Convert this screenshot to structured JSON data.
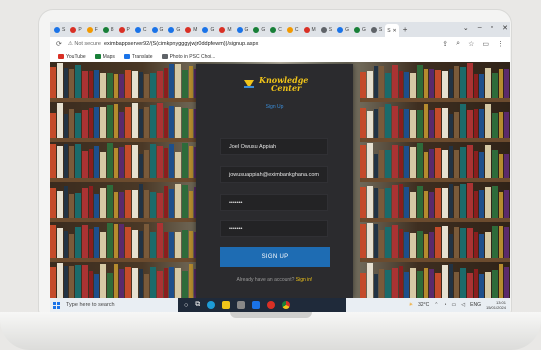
{
  "browser": {
    "tabs": [
      {
        "label": "S",
        "color": "#1a73e8"
      },
      {
        "label": "P",
        "color": "#d93025"
      },
      {
        "label": "F",
        "color": "#f29900"
      },
      {
        "label": "8",
        "color": "#188038"
      },
      {
        "label": "P",
        "color": "#d93025"
      },
      {
        "label": "C",
        "color": "#1a73e8"
      },
      {
        "label": "G",
        "color": "#1a73e8"
      },
      {
        "label": "G",
        "color": "#1a73e8"
      },
      {
        "label": "M",
        "color": "#d93025"
      },
      {
        "label": "G",
        "color": "#1a73e8"
      },
      {
        "label": "M",
        "color": "#d93025"
      },
      {
        "label": "G",
        "color": "#1a73e8"
      },
      {
        "label": "G",
        "color": "#188038"
      },
      {
        "label": "C",
        "color": "#188038"
      },
      {
        "label": "C",
        "color": "#f29900"
      },
      {
        "label": "M",
        "color": "#d93025"
      },
      {
        "label": "S",
        "color": "#5f6368"
      },
      {
        "label": "G",
        "color": "#1a73e8"
      },
      {
        "label": "G",
        "color": "#188038"
      },
      {
        "label": "S",
        "color": "#5f6368"
      }
    ],
    "active_tab": "S",
    "new_tab": "+",
    "secure_label": "Not secure",
    "url": "eximbappserver92/(S(cimkpnygggyjwjr0ddpfewm))/signup.aspx",
    "bookmarks": [
      {
        "label": "YouTube",
        "color": "#d93025"
      },
      {
        "label": "Maps",
        "color": "#188038"
      },
      {
        "label": "Translate",
        "color": "#1a73e8"
      },
      {
        "label": "Photo in PSC Choi...",
        "color": "#5f6368"
      }
    ]
  },
  "page": {
    "logo_line1": "Knowledge",
    "logo_line2": "Center",
    "title": "Sign Up",
    "fields": {
      "name": "Joel Owusu Appiah",
      "email": "jowusuappiah@eximbankghana.com",
      "password": "•••••••",
      "confirm_password": "•••••••"
    },
    "signup_button": "SIGN UP",
    "already_text": "Already have an account?",
    "signin_link": "Sign in!"
  },
  "taskbar": {
    "search_placeholder": "Type here to search",
    "weather": "32°C",
    "lang": "ENG",
    "time": "13:01",
    "date": "15/01/2024"
  }
}
